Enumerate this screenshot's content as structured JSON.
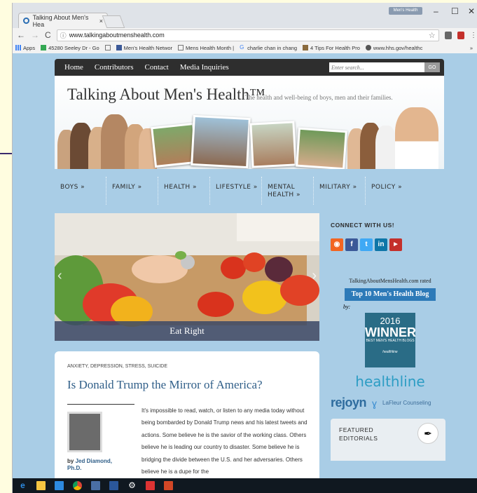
{
  "browser": {
    "tab_title": "Talking About Men's Hea",
    "tab_close": "×",
    "user_badge": "Men's Health",
    "window_controls": [
      "–",
      "☐",
      "✕"
    ],
    "url": "www.talkingaboutmenshealth.com",
    "nav_back": "←",
    "nav_forward": "→",
    "nav_reload": "C",
    "bookmarks": [
      "Apps",
      "45280 Seeley Dr - Go",
      "Men's Health Networ",
      "Mens Health Month |",
      "charlie chan in chang",
      "4 Tips For Health Pro",
      "www.hhs.gov/healthc"
    ],
    "bookmarks_more": "»"
  },
  "site": {
    "nav": [
      "Home",
      "Contributors",
      "Contact",
      "Media Inquiries"
    ],
    "search_placeholder": "Enter search...",
    "search_button": "GO",
    "title": "Talking About Men's Health™",
    "tagline": "The health and well-being of boys, men and their families.",
    "categories": [
      "BOYS »",
      "FAMILY »",
      "HEALTH »",
      "LIFESTYLE »",
      "MENTAL HEALTH »",
      "MILITARY »",
      "POLICY »"
    ],
    "slider": {
      "caption": "Eat Right",
      "prev": "‹",
      "next": "›"
    },
    "article": {
      "categories": "ANXIETY, DEPRESSION, STRESS, SUICIDE",
      "title": "Is Donald Trump the Mirror of America?",
      "author_prefix": "by",
      "author_name": "Jed Diamond, Ph.D.",
      "body": "It's impossible to read, watch, or listen to any media today without being bombarded by Donald Trump news and his latest tweets and actions. Some believe he is the savior of the working class. Others believe he is leading our country to disaster. Some believe he is bridging the divide between the U.S. and her adversaries. Others believe he is a dupe for the"
    },
    "sidebar": {
      "connect_title": "CONNECT WITH US!",
      "rated_text": "TalkingAboutMensHealth.com rated",
      "ribbon_text": "Top 10 Men's Health Blog",
      "by_text": "by:",
      "winner_year": "2016",
      "winner_word": "WINNER",
      "winner_sub": "BEST MEN'S HEALTH BLOGS",
      "winner_brand": "healthline",
      "healthline_logo": "healthline",
      "rejoyn_logo": "rejoyn",
      "lafleur_logo": "LaFleur Counseling",
      "featured_title": "FEATURED EDITORIALS"
    }
  },
  "colors": {
    "page_bg": "#a9cde6",
    "nav_bg": "#2e2e2e",
    "link_blue": "#2f5e88",
    "rss": "#f26522",
    "facebook": "#3b5998",
    "twitter": "#3fa9f5",
    "linkedin": "#0e76a8",
    "youtube": "#c4302b"
  },
  "taskbar_icons": [
    "edge-icon",
    "file-explorer-icon",
    "store-icon",
    "chrome-icon",
    "app-icon",
    "word-icon",
    "settings-icon",
    "acrobat-icon",
    "powerpoint-icon"
  ]
}
